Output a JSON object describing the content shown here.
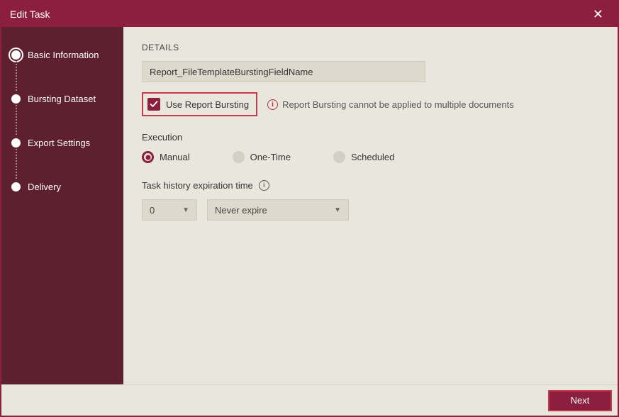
{
  "window": {
    "title": "Edit Task"
  },
  "sidebar": {
    "steps": [
      {
        "label": "Basic Information",
        "active": true
      },
      {
        "label": "Bursting Dataset",
        "active": false
      },
      {
        "label": "Export Settings",
        "active": false
      },
      {
        "label": "Delivery",
        "active": false
      }
    ]
  },
  "details": {
    "heading": "DETAILS",
    "name_value": "Report_FileTemplateBurstingFieldName",
    "use_bursting_label": "Use Report Bursting",
    "use_bursting_checked": true,
    "warning_text": "Report Bursting cannot be applied to multiple documents"
  },
  "execution": {
    "heading": "Execution",
    "options": [
      {
        "label": "Manual",
        "selected": true
      },
      {
        "label": "One-Time",
        "selected": false
      },
      {
        "label": "Scheduled",
        "selected": false
      }
    ]
  },
  "history": {
    "label": "Task history expiration time",
    "count_value": "0",
    "expire_value": "Never expire"
  },
  "footer": {
    "next_label": "Next"
  }
}
